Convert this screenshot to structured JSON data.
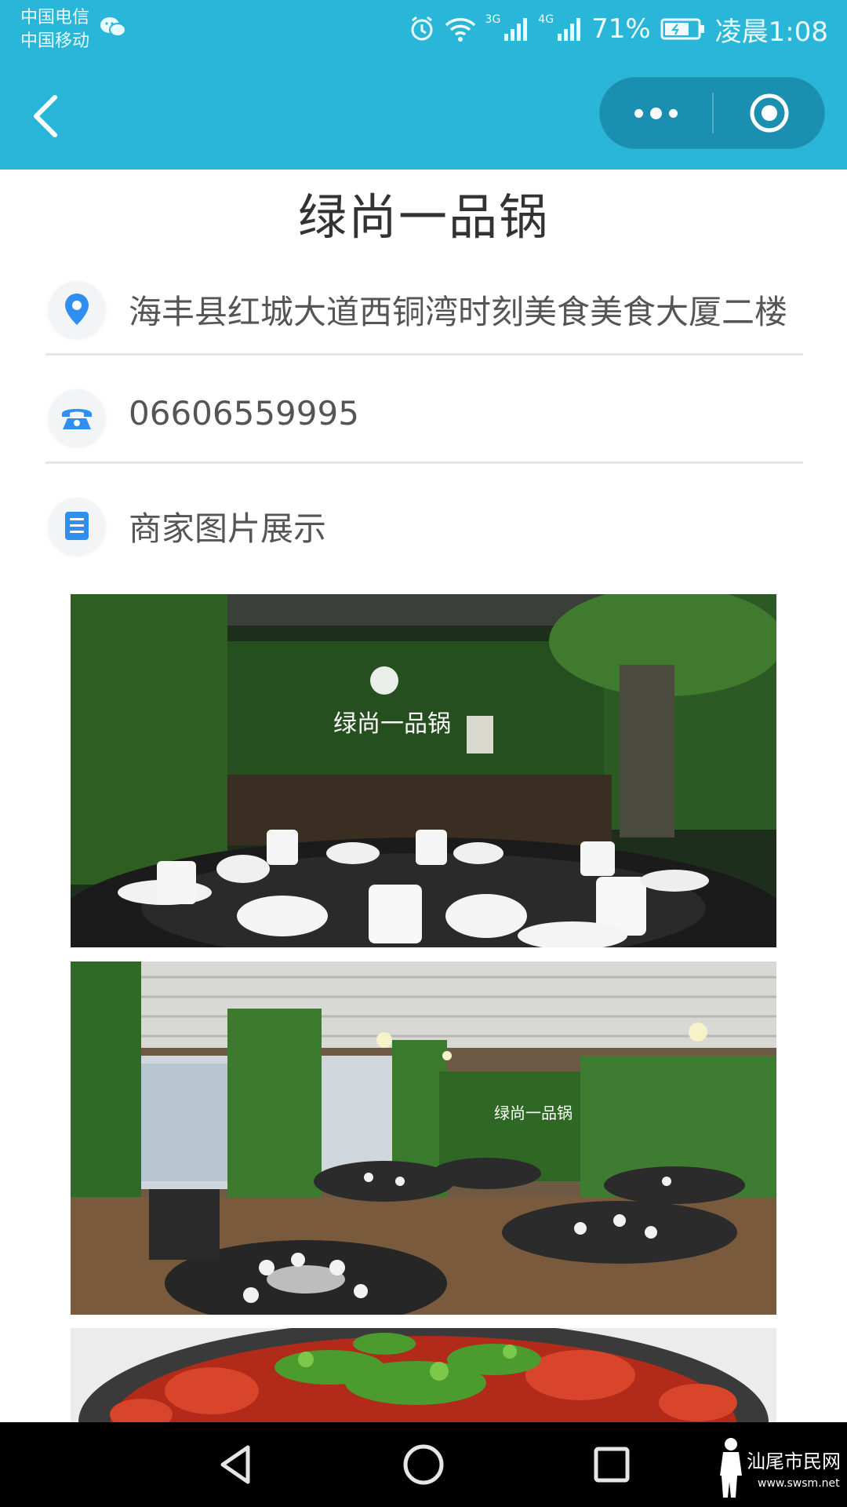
{
  "status_bar": {
    "carrier_1": "中国电信",
    "carrier_2": "中国移动",
    "net_1": "3G",
    "net_2": "4G",
    "battery": "71%",
    "time": "凌晨1:08",
    "icons": [
      "wechat-icon",
      "alarm-icon",
      "wifi-icon",
      "signal-icon",
      "battery-icon"
    ]
  },
  "nav": {
    "back_icon": "chevron-left-icon",
    "more_icon": "more-dots-icon",
    "close_icon": "target-circle-icon",
    "accent_color": "#29b6d8"
  },
  "page": {
    "title": "绿尚一品锅",
    "address": "海丰县红城大道西铜湾时刻美食美食大厦二楼",
    "phone": "06606559995",
    "photos_label": "商家图片展示",
    "photo_items": [
      {
        "name": "restaurant-interior-photo-1",
        "sign_text": "绿尚一品锅"
      },
      {
        "name": "restaurant-interior-photo-2",
        "sign_text": "绿尚一品锅"
      },
      {
        "name": "crayfish-dish-photo"
      }
    ]
  },
  "system_nav": {
    "icons": [
      "back-triangle-icon",
      "home-circle-icon",
      "recents-square-icon"
    ]
  },
  "watermark": {
    "text": "汕尾市民网",
    "url": "www.swsm.net"
  }
}
